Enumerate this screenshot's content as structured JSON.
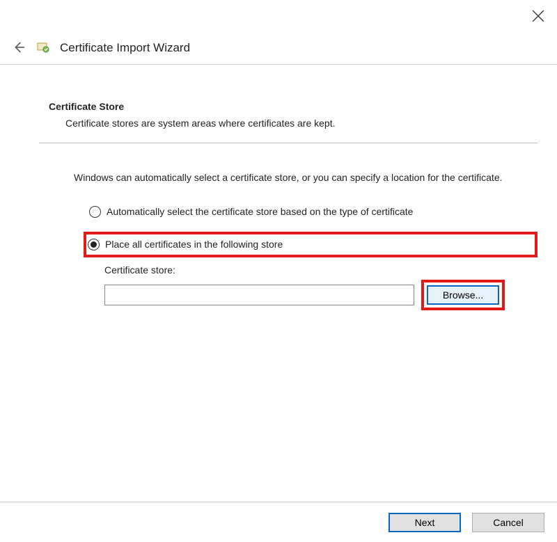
{
  "window": {
    "title": "Certificate Import Wizard"
  },
  "section": {
    "heading": "Certificate Store",
    "description": "Certificate stores are system areas where certificates are kept."
  },
  "intro": "Windows can automatically select a certificate store, or you can specify a location for the certificate.",
  "options": {
    "auto": "Automatically select the certificate store based on the type of certificate",
    "manual": "Place all certificates in the following store"
  },
  "store": {
    "label": "Certificate store:",
    "value": "",
    "browse": "Browse..."
  },
  "buttons": {
    "next": "Next",
    "cancel": "Cancel"
  }
}
